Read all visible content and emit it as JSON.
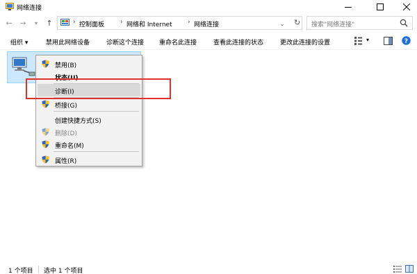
{
  "window": {
    "title": "网络连接",
    "minimize_icon": "minimize-icon",
    "maximize_icon": "maximize-icon",
    "close_icon": "close-icon"
  },
  "address": {
    "breadcrumbs": [
      "控制面板",
      "网络和 Internet",
      "网络连接"
    ],
    "search_placeholder": "搜索\"网络连接\""
  },
  "toolbar": {
    "organize": "组织 ▾",
    "items": [
      "禁用此网络设备",
      "诊断这个连接",
      "重命名此连接",
      "查看此连接的状态",
      "更改此连接的设置"
    ]
  },
  "context_menu": {
    "items": [
      {
        "label": "禁用(B)",
        "shield": true
      },
      {
        "label": "状态(U)",
        "bold": true
      },
      {
        "label": "诊断(I)",
        "hover": true
      },
      {
        "label": "桥接(G)",
        "shield": true
      },
      {
        "label": "创建快捷方式(S)"
      },
      {
        "label": "删除(D)",
        "shield": true,
        "disabled": true
      },
      {
        "label": "重命名(M)",
        "shield": true
      },
      {
        "label": "属性(R)",
        "shield": true
      }
    ]
  },
  "status": {
    "count": "1 个项目",
    "selected": "选中 1 个项目"
  },
  "colors": {
    "selection": "#cce8ff",
    "highlight_box": "#e03131",
    "help": "#1e6fd9"
  }
}
